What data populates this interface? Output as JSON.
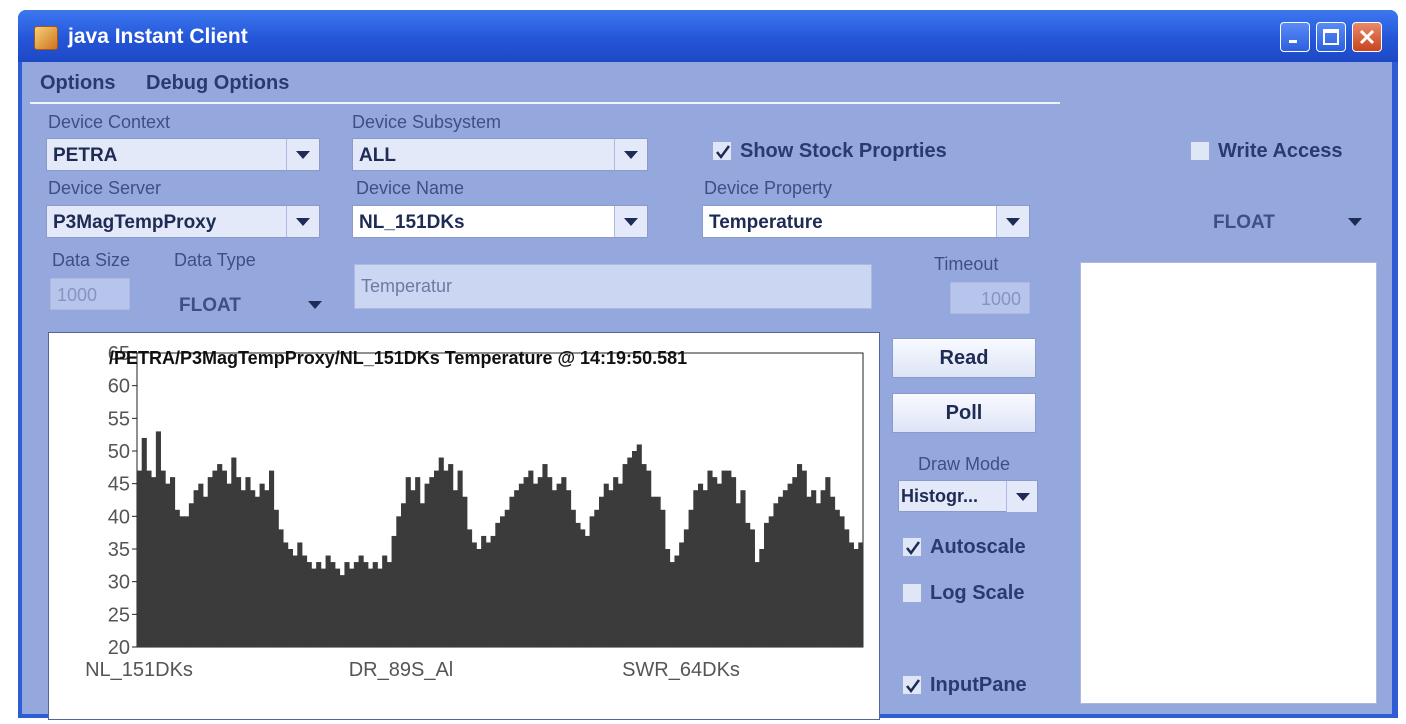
{
  "window": {
    "title": "java Instant Client",
    "icon": "java-cup-icon"
  },
  "menu": [
    "Options",
    "Debug Options"
  ],
  "fields": {
    "device_context": {
      "label": "Device Context",
      "value": "PETRA"
    },
    "device_subsystem": {
      "label": "Device Subsystem",
      "value": "ALL"
    },
    "device_server": {
      "label": "Device Server",
      "value": "P3MagTempProxy"
    },
    "device_name": {
      "label": "Device Name",
      "value": "NL_151DKs"
    },
    "device_property": {
      "label": "Device Property",
      "value": "Temperature"
    },
    "data_size": {
      "label": "Data Size",
      "value": "1000"
    },
    "data_type": {
      "label": "Data Type",
      "value": "FLOAT"
    },
    "description": {
      "value": "Temperatur"
    },
    "timeout": {
      "label": "Timeout",
      "value": "1000"
    },
    "right_type": {
      "value": "FLOAT"
    }
  },
  "checkboxes": {
    "show_stock": {
      "label": "Show Stock Proprties",
      "checked": true
    },
    "write_access": {
      "label": "Write Access",
      "checked": false
    },
    "autoscale": {
      "label": "Autoscale",
      "checked": true
    },
    "log_scale": {
      "label": "Log Scale",
      "checked": false
    },
    "input_pane": {
      "label": "InputPane",
      "checked": true
    }
  },
  "buttons": {
    "read": "Read",
    "poll": "Poll"
  },
  "draw_mode": {
    "label": "Draw Mode",
    "value": "Histogr..."
  },
  "colors": {
    "title_bar": "#2456d8",
    "panel": "#95a8de",
    "bars": "#3b3b3b"
  },
  "chart_data": {
    "type": "bar",
    "title": "/PETRA/P3MagTempProxy/NL_151DKs Temperature @ 14:19:50.581",
    "ylim": [
      20,
      65
    ],
    "yticks": [
      20,
      25,
      30,
      35,
      40,
      45,
      50,
      55,
      60,
      65
    ],
    "xtick_labels": [
      "NL_151DKs",
      "DR_89S_Al",
      "SWR_64DKs"
    ],
    "values": [
      47,
      52,
      47,
      46,
      53,
      47,
      45,
      46,
      41,
      40,
      40,
      42,
      44,
      45,
      43,
      46,
      47,
      48,
      47,
      45,
      49,
      46,
      44,
      46,
      44,
      43,
      45,
      44,
      47,
      41,
      38,
      36,
      35,
      34,
      36,
      34,
      33,
      32,
      33,
      32,
      34,
      33,
      32,
      31,
      33,
      32,
      33,
      34,
      33,
      32,
      33,
      32,
      34,
      33,
      37,
      40,
      42,
      46,
      44,
      46,
      42,
      45,
      46,
      47,
      49,
      47,
      48,
      44,
      47,
      43,
      38,
      36,
      35,
      37,
      36,
      37,
      39,
      40,
      41,
      43,
      44,
      45,
      46,
      47,
      45,
      46,
      48,
      46,
      44,
      45,
      46,
      44,
      41,
      39,
      38,
      37,
      40,
      41,
      43,
      45,
      44,
      46,
      45,
      48,
      49,
      50,
      51,
      48,
      47,
      43,
      43,
      41,
      35,
      33,
      34,
      36,
      38,
      41,
      44,
      45,
      44,
      47,
      46,
      45,
      47,
      47,
      46,
      42,
      44,
      39,
      38,
      33,
      35,
      39,
      40,
      42,
      43,
      44,
      45,
      46,
      48,
      47,
      43,
      44,
      42,
      44,
      46,
      43,
      41,
      40,
      38,
      36,
      35,
      36
    ]
  }
}
